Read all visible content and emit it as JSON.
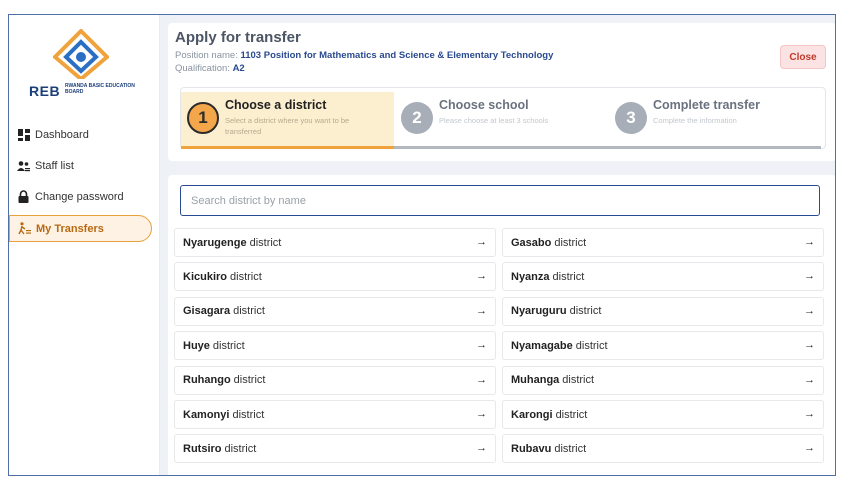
{
  "sidebar": {
    "logo_text": "REB",
    "logo_subtext": "RWANDA BASIC EDUCATION BOARD",
    "items": [
      {
        "label": "Dashboard",
        "icon": "dashboard-icon"
      },
      {
        "label": "Staff list",
        "icon": "staff-icon"
      },
      {
        "label": "Change password",
        "icon": "lock-icon"
      },
      {
        "label": "My Transfers",
        "icon": "transfer-icon"
      }
    ]
  },
  "header": {
    "title": "Apply for transfer",
    "position_label": "Position name:",
    "position_value": "1103 Position for Mathematics and Science & Elementary Technology",
    "qualification_label": "Qualification:",
    "qualification_value": "A2",
    "close_label": "Close"
  },
  "stepper": {
    "progress_fraction": 0.333,
    "steps": [
      {
        "number": "1",
        "title": "Choose a district",
        "subtitle": "Select a district where you want to be transferred"
      },
      {
        "number": "2",
        "title": "Choose school",
        "subtitle": "Please choose at least 3 schools"
      },
      {
        "number": "3",
        "title": "Complete transfer",
        "subtitle": "Complete the information"
      }
    ]
  },
  "search": {
    "placeholder": "Search district by name",
    "value": ""
  },
  "district_suffix": "district",
  "districts": [
    "Nyarugenge",
    "Gasabo",
    "Kicukiro",
    "Nyanza",
    "Gisagara",
    "Nyaruguru",
    "Huye",
    "Nyamagabe",
    "Ruhango",
    "Muhanga",
    "Kamonyi",
    "Karongi",
    "Rutsiro",
    "Rubavu"
  ],
  "colors": {
    "accent": "#f0a23c",
    "brand": "#2a4a8f",
    "danger": "#c0392b"
  }
}
